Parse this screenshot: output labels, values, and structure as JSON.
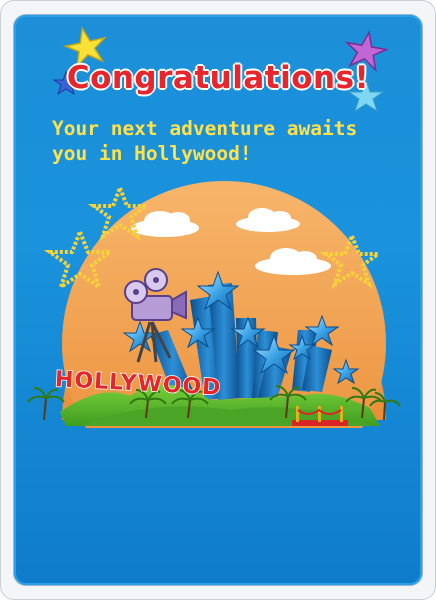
{
  "card": {
    "title": "Congratulations!",
    "message_line1": "Your next adventure awaits",
    "message_line2": "you in Hollywood!",
    "sign_text": "HOLLYWOOD"
  },
  "colors": {
    "background": "#1a92dc",
    "title": "#e8252c",
    "message": "#ffe14a",
    "sun": "#f1a04f",
    "grass": "#59b82a",
    "sign": "#e2262a"
  },
  "icons": [
    "star-icon",
    "cloud-icon",
    "film-camera-icon",
    "palm-tree-icon",
    "red-carpet-icon"
  ]
}
